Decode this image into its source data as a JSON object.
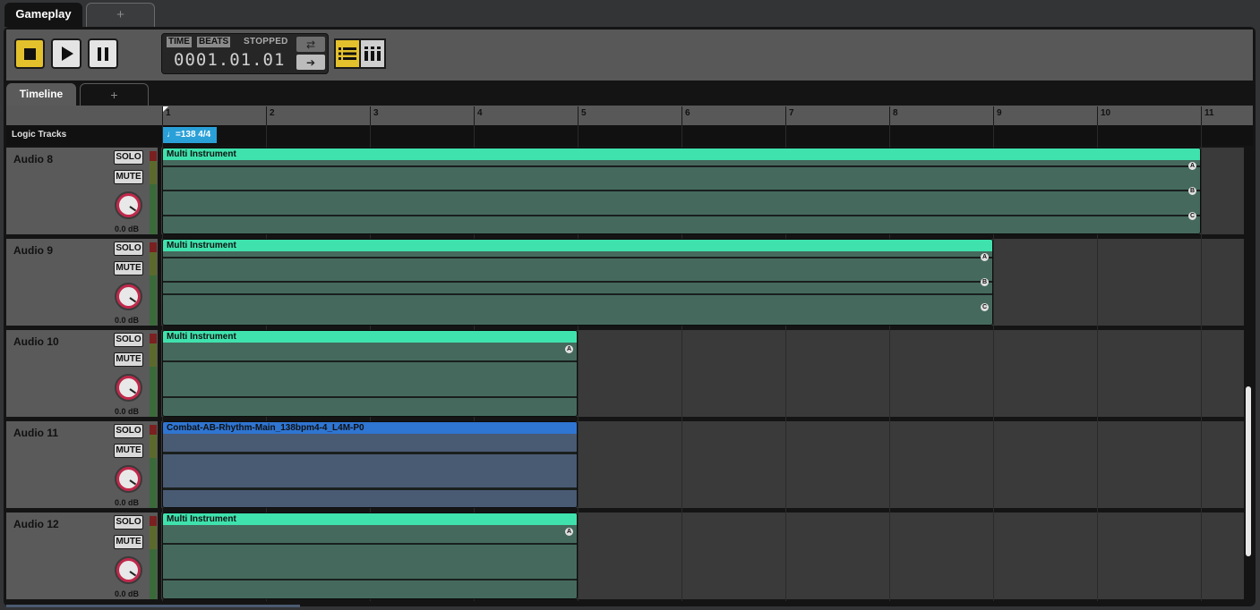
{
  "top_tabs": {
    "active": "Gameplay",
    "add": "+"
  },
  "transport": {
    "time_label": "TIME",
    "beats_label": "BEATS",
    "status": "STOPPED",
    "counter": "0001.01.01"
  },
  "timeline_tabs": {
    "active": "Timeline",
    "add": "+"
  },
  "ruler": {
    "bars": [
      "1",
      "2",
      "3",
      "4",
      "5",
      "6",
      "7",
      "8",
      "9",
      "10",
      "11"
    ]
  },
  "logic": {
    "label": "Logic Tracks",
    "tempo": "♩=138 4/4"
  },
  "tracks": [
    {
      "name": "Audio 8",
      "solo": "SOLO",
      "mute": "MUTE",
      "db": "0.0 dB",
      "clip": "Multi Instrument",
      "layers": [
        "A",
        "B",
        "C"
      ]
    },
    {
      "name": "Audio 9",
      "solo": "SOLO",
      "mute": "MUTE",
      "db": "0.0 dB",
      "clip": "Multi Instrument",
      "layers": [
        "A",
        "B",
        "C"
      ]
    },
    {
      "name": "Audio 10",
      "solo": "SOLO",
      "mute": "MUTE",
      "db": "0.0 dB",
      "clip": "Multi Instrument",
      "layers": [
        "A"
      ]
    },
    {
      "name": "Audio 11",
      "solo": "SOLO",
      "mute": "MUTE",
      "db": "0.0 dB",
      "clip": "Combat-AB-Rhythm-Main_138bpm4-4_L4M-P0",
      "layers": []
    },
    {
      "name": "Audio 12",
      "solo": "SOLO",
      "mute": "MUTE",
      "db": "0.0 dB",
      "clip": "Multi Instrument",
      "layers": [
        "A"
      ]
    }
  ],
  "colors": {
    "accent": "#e3c12d",
    "clip_green": "#3fe2ad",
    "clip_blue": "#2f75d2",
    "tempo": "#2aa0d8",
    "knob": "#c0284a"
  }
}
